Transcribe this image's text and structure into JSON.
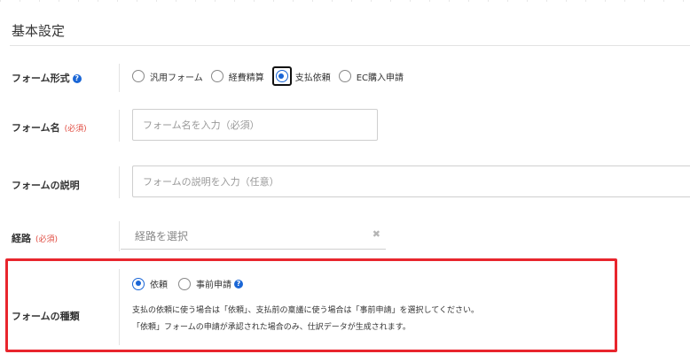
{
  "section": {
    "title": "基本設定"
  },
  "form_type": {
    "label": "フォーム形式",
    "help_icon": "question-circle-icon",
    "options": [
      "汎用フォーム",
      "経費精算",
      "支払依頼",
      "EC購入申請"
    ],
    "selected": "支払依頼"
  },
  "form_name": {
    "label": "フォーム名",
    "required": "(必須)",
    "placeholder": "フォーム名を入力（必須）"
  },
  "form_description": {
    "label": "フォームの説明",
    "placeholder": "フォームの説明を入力（任意）"
  },
  "route": {
    "label": "経路",
    "required": "(必須)",
    "placeholder": "経路を選択",
    "clear_icon": "close-icon"
  },
  "form_kind": {
    "label": "フォームの種類",
    "options": [
      "依頼",
      "事前申請"
    ],
    "selected": "依頼",
    "help_icon": "question-circle-icon",
    "description_line1": "支払の依頼に使う場合は「依頼」、支払前の稟議に使う場合は「事前申請」を選択してください。",
    "description_line2": "「依頼」フォームの申請が承認された場合のみ、仕訳データが生成されます。"
  },
  "colors": {
    "accent": "#1a66d6",
    "required": "#e04a3f",
    "highlight_border": "#e8252d"
  }
}
